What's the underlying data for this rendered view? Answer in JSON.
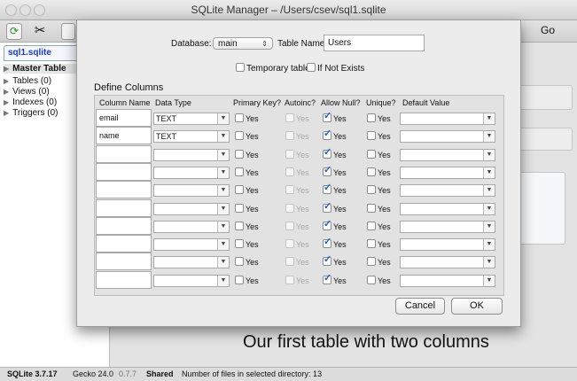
{
  "window": {
    "title": "SQLite Manager – /Users/csev/sql1.sqlite"
  },
  "toolbar": {
    "go_label": "Go",
    "refresh_icon": "refresh-icon",
    "tools_icon": "tools-icon"
  },
  "sidebar": {
    "db_tab": "sql1.sqlite",
    "items": [
      {
        "label": "Master Table"
      },
      {
        "label": "Tables (0)"
      },
      {
        "label": "Views (0)"
      },
      {
        "label": "Indexes (0)"
      },
      {
        "label": "Triggers (0)"
      }
    ]
  },
  "dialog": {
    "database_label": "Database:",
    "database_value": "main",
    "table_name_label": "Table Name:",
    "table_name_value": "Users",
    "temporary_label": "Temporary table",
    "if_not_exists_label": "If Not Exists",
    "define_columns_label": "Define Columns",
    "headers": {
      "column_name": "Column Name",
      "data_type": "Data Type",
      "primary_key": "Primary Key?",
      "autoinc": "Autoinc?",
      "allow_null": "Allow Null?",
      "unique": "Unique?",
      "default_value": "Default Value"
    },
    "yes_label": "Yes",
    "rows": [
      {
        "name": "email",
        "type": "TEXT",
        "pk": false,
        "autoinc": false,
        "allow_null": true,
        "unique": false,
        "default": ""
      },
      {
        "name": "name",
        "type": "TEXT",
        "pk": false,
        "autoinc": false,
        "allow_null": true,
        "unique": false,
        "default": ""
      },
      {
        "name": "",
        "type": "",
        "pk": false,
        "autoinc": false,
        "allow_null": true,
        "unique": false,
        "default": ""
      },
      {
        "name": "",
        "type": "",
        "pk": false,
        "autoinc": false,
        "allow_null": true,
        "unique": false,
        "default": ""
      },
      {
        "name": "",
        "type": "",
        "pk": false,
        "autoinc": false,
        "allow_null": true,
        "unique": false,
        "default": ""
      },
      {
        "name": "",
        "type": "",
        "pk": false,
        "autoinc": false,
        "allow_null": true,
        "unique": false,
        "default": ""
      },
      {
        "name": "",
        "type": "",
        "pk": false,
        "autoinc": false,
        "allow_null": true,
        "unique": false,
        "default": ""
      },
      {
        "name": "",
        "type": "",
        "pk": false,
        "autoinc": false,
        "allow_null": true,
        "unique": false,
        "default": ""
      },
      {
        "name": "",
        "type": "",
        "pk": false,
        "autoinc": false,
        "allow_null": true,
        "unique": false,
        "default": ""
      },
      {
        "name": "",
        "type": "",
        "pk": false,
        "autoinc": false,
        "allow_null": true,
        "unique": false,
        "default": ""
      }
    ],
    "cancel_label": "Cancel",
    "ok_label": "OK"
  },
  "caption": "Our first table with two columns",
  "status": {
    "sqlite": "SQLite 3.7.17",
    "gecko": "Gecko 24.0",
    "version": "0.7.7",
    "shared": "Shared",
    "files": "Number of files in selected directory: 13"
  },
  "colors": {
    "checkmark": "#1d5fd6",
    "db_tab_text": "#1a3cbc"
  }
}
